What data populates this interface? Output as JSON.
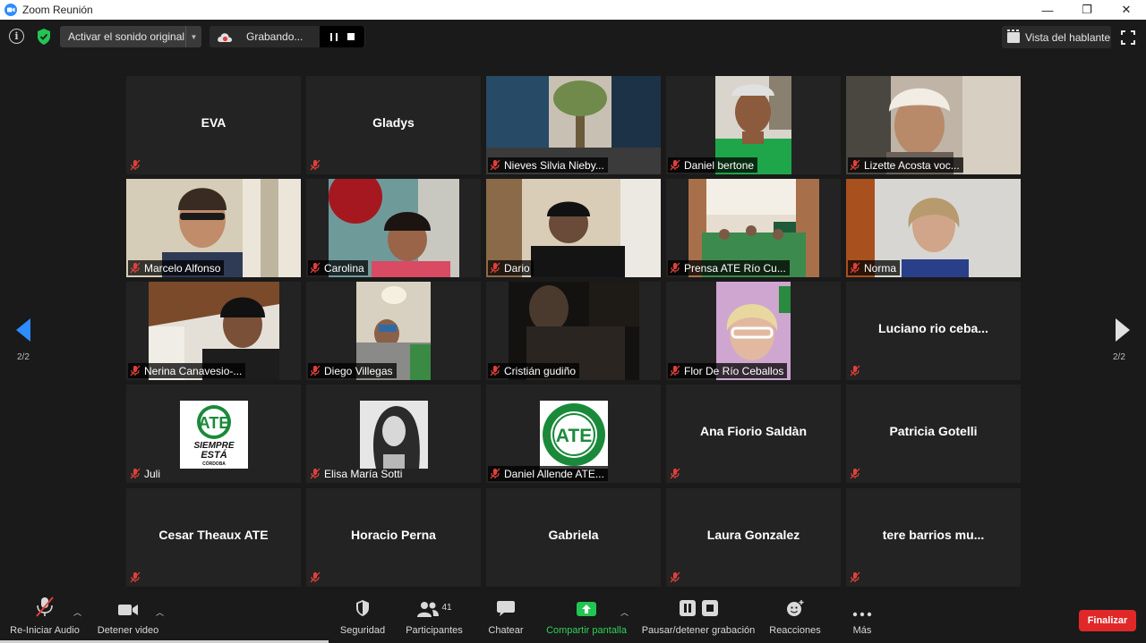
{
  "window": {
    "title": "Zoom Reunión",
    "controls": [
      "—",
      "❐",
      "✕"
    ]
  },
  "topbar": {
    "unmute_label": "Activar el sonido original",
    "recording_label": "Grabando...",
    "view_label": "Vista del hablante"
  },
  "gallery": {
    "page_indicator": "2/2",
    "tiles": [
      {
        "name": "EVA",
        "video": false
      },
      {
        "name": "Gladys",
        "video": false
      },
      {
        "name": "Nieves Silvia Nieby...",
        "video": true
      },
      {
        "name": "Daniel bertone",
        "video": true
      },
      {
        "name": "Lizette Acosta voc...",
        "video": true
      },
      {
        "name": "Marcelo Alfonso",
        "video": true
      },
      {
        "name": "Carolina",
        "video": true
      },
      {
        "name": "Dario",
        "video": true
      },
      {
        "name": "Prensa ATE Río Cu...",
        "video": true
      },
      {
        "name": "Norma",
        "video": true
      },
      {
        "name": "Nerina Canavesio-...",
        "video": true
      },
      {
        "name": "Diego Villegas",
        "video": true
      },
      {
        "name": "Cristián gudiño",
        "video": true
      },
      {
        "name": "Flor De Río Ceballos",
        "video": true
      },
      {
        "name": "Luciano rio ceba...",
        "video": false
      },
      {
        "name": "Juli",
        "video": true
      },
      {
        "name": "Elisa María Sotti",
        "video": true
      },
      {
        "name": "Daniel Allende ATE...",
        "video": true
      },
      {
        "name": "Ana Fiorio Saldàn",
        "video": false
      },
      {
        "name": "Patricia Gotelli",
        "video": false
      },
      {
        "name": "Cesar Theaux ATE",
        "video": false
      },
      {
        "name": "Horacio Perna",
        "video": false
      },
      {
        "name": "Gabriela",
        "video": false
      },
      {
        "name": "Laura Gonzalez",
        "video": false
      },
      {
        "name": "tere barrios mu...",
        "video": false
      }
    ],
    "logos": {
      "juli_logo_top": "ATE",
      "juli_logo_mid": "SIEMPRE",
      "juli_logo_bottom": "ESTÁ",
      "juli_logo_sub": "CÓRDOBA",
      "allende_logo": "ATE",
      "allende_logo_ring": "Noroeste Córdoba · Seccional Cruz del Eje"
    }
  },
  "toolbar": {
    "audio_label": "Re-Iniciar Audio",
    "video_label": "Detener video",
    "security_label": "Seguridad",
    "participants_label": "Participantes",
    "participants_count": "41",
    "chat_label": "Chatear",
    "share_label": "Compartir pantalla",
    "record_label": "Pausar/detener grabación",
    "reactions_label": "Reacciones",
    "more_label": "Más",
    "end_label": "Finalizar"
  },
  "colors": {
    "accent_blue": "#2d8cff",
    "share_green": "#2fd158",
    "end_red": "#e02828",
    "mic_off_red": "#e0403a"
  }
}
